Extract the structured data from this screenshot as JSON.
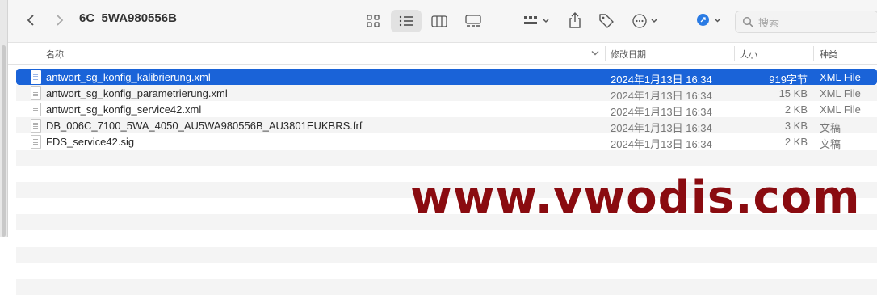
{
  "window": {
    "title": "6C_5WA980556B"
  },
  "toolbar": {
    "back_icon": "chevron-left-icon",
    "forward_icon": "chevron-right-icon",
    "views": [
      "icon-view",
      "list-view",
      "column-view",
      "gallery-view"
    ],
    "active_view": "list-view",
    "search_placeholder": "搜索"
  },
  "columns": {
    "name": "名称",
    "date": "修改日期",
    "size": "大小",
    "kind": "种类"
  },
  "files": [
    {
      "name": "antwort_sg_konfig_kalibrierung.xml",
      "date": "2024年1月13日 16:34",
      "size": "919字节",
      "kind": "XML File",
      "selected": true
    },
    {
      "name": "antwort_sg_konfig_parametrierung.xml",
      "date": "2024年1月13日 16:34",
      "size": "15 KB",
      "kind": "XML File"
    },
    {
      "name": "antwort_sg_konfig_service42.xml",
      "date": "2024年1月13日 16:34",
      "size": "2 KB",
      "kind": "XML File"
    },
    {
      "name": "DB_006C_7100_5WA_4050_AU5WA980556B_AU3801EUKBRS.frf",
      "date": "2024年1月13日 16:34",
      "size": "3 KB",
      "kind": "文稿"
    },
    {
      "name": "FDS_service42.sig",
      "date": "2024年1月13日 16:34",
      "size": "2 KB",
      "kind": "文稿"
    }
  ],
  "watermark": "www.vwodis.com",
  "colors": {
    "selection": "#1a63d8",
    "watermark": "#8a0b10"
  }
}
